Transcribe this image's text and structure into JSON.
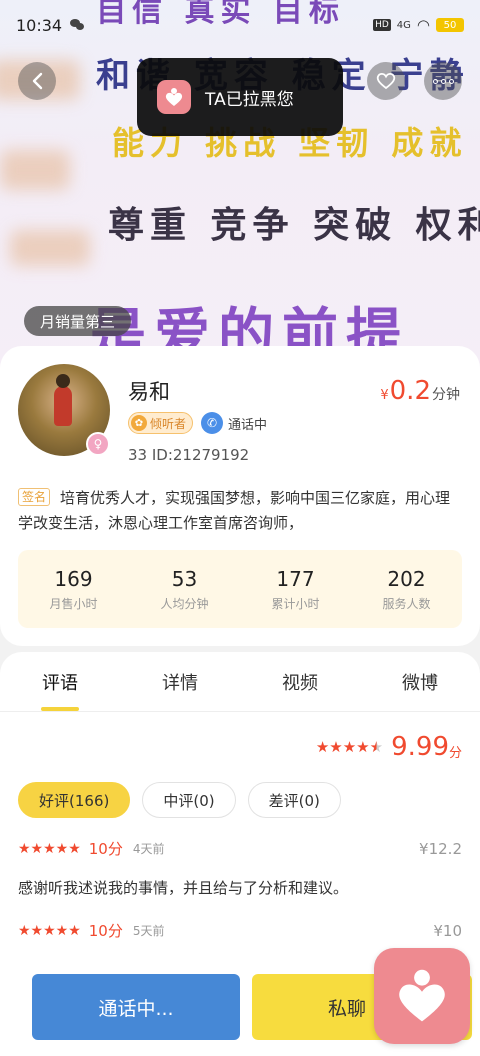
{
  "status_bar": {
    "time": "10:34",
    "battery": "50",
    "hd": "HD",
    "signal": "4G"
  },
  "banner": {
    "rows": [
      "自信 真实 目标",
      "和谐 宽容 稳定 宁静",
      "能力 挑战 坚韧 成就",
      "尊重 竞争 突破 权利",
      "是爱的前提"
    ],
    "sales_badge": "月销量第三"
  },
  "toast": {
    "text": "TA已拉黑您"
  },
  "profile": {
    "name": "易和",
    "price_symbol": "¥",
    "price_value": "0.2",
    "price_unit": "分钟",
    "listener_tag": "倾听者",
    "call_status": "通话中",
    "id_line": "33  ID:21279192",
    "sign_label": "签名",
    "sign_text": "培育优秀人才，实现强国梦想，影响中国三亿家庭，用心理学改变生活，沐恩心理工作室首席咨询师，"
  },
  "stats": [
    {
      "value": "169",
      "label": "月售小时"
    },
    {
      "value": "53",
      "label": "人均分钟"
    },
    {
      "value": "177",
      "label": "累计小时"
    },
    {
      "value": "202",
      "label": "服务人数"
    }
  ],
  "tabs": [
    {
      "label": "评语"
    },
    {
      "label": "详情"
    },
    {
      "label": "视频"
    },
    {
      "label": "微博"
    }
  ],
  "rating": {
    "stars": 4.5,
    "score": "9.99",
    "unit": "分"
  },
  "filters": [
    {
      "label": "好评(166)"
    },
    {
      "label": "中评(0)"
    },
    {
      "label": "差评(0)"
    }
  ],
  "reviews": [
    {
      "score": "10分",
      "time": "4天前",
      "amount": "¥12.2",
      "text": "感谢听我述说我的事情，并且给与了分析和建议。"
    },
    {
      "score": "10分",
      "time": "5天前",
      "amount": "¥10",
      "text": ""
    }
  ],
  "bottom": {
    "call_label": "通话中...",
    "message_label": "私聊"
  },
  "colors": {
    "accent_red": "#f04a2f",
    "accent_yellow": "#f7d343",
    "call_blue": "#4688d6",
    "logo_pink": "#ee8a90"
  },
  "icons": [
    "back-icon",
    "heart-outline-icon",
    "more-icon",
    "heart-logo-icon",
    "phone-icon",
    "listener-badge-icon",
    "star-icon"
  ]
}
